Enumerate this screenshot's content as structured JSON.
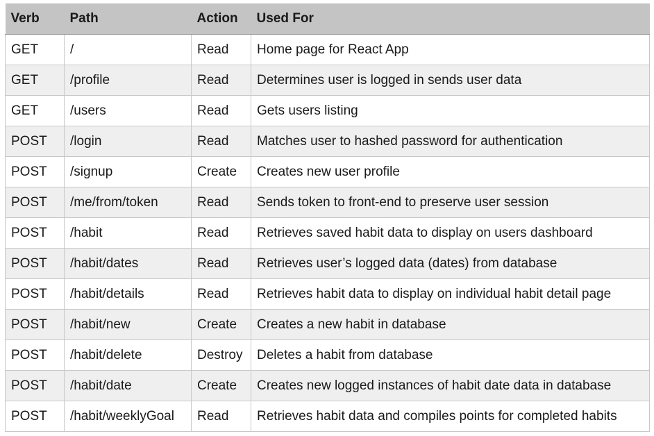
{
  "table": {
    "headers": [
      "Verb",
      "Path",
      "Action",
      "Used For"
    ],
    "rows": [
      [
        "GET",
        "/",
        "Read",
        "Home page for React App"
      ],
      [
        "GET",
        "/profile",
        "Read",
        "Determines user is logged in sends user data"
      ],
      [
        "GET",
        "/users",
        "Read",
        "Gets users listing"
      ],
      [
        "POST",
        "/login",
        "Read",
        "Matches user to hashed password for authentication"
      ],
      [
        "POST",
        "/signup",
        "Create",
        "Creates new user profile"
      ],
      [
        "POST",
        "/me/from/token",
        "Read",
        "Sends token to front-end to preserve user session"
      ],
      [
        "POST",
        "/habit",
        "Read",
        "Retrieves saved habit data to display on users dashboard"
      ],
      [
        "POST",
        "/habit/dates",
        "Read",
        "Retrieves user’s logged data (dates) from database"
      ],
      [
        "POST",
        "/habit/details",
        "Read",
        "Retrieves habit data to display on individual habit detail page"
      ],
      [
        "POST",
        "/habit/new",
        "Create",
        "Creates a new habit in database"
      ],
      [
        "POST",
        "/habit/delete",
        "Destroy",
        "Deletes a habit from database"
      ],
      [
        "POST",
        "/habit/date",
        "Create",
        "Creates new logged instances of habit date data in database"
      ],
      [
        "POST",
        "/habit/weeklyGoal",
        "Read",
        "Retrieves habit data and compiles points for completed habits"
      ]
    ]
  }
}
